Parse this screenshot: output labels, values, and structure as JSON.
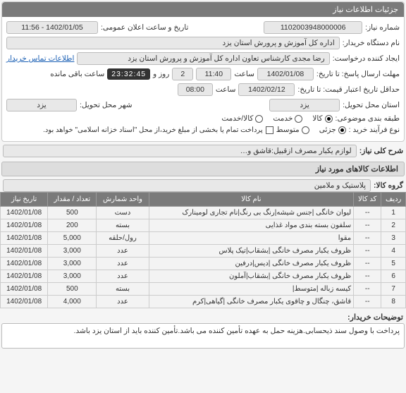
{
  "panel_title": "جزئیات اطلاعات نیاز",
  "fields": {
    "need_no_label": "شماره نیاز:",
    "need_no": "1102003948000006",
    "announce_label": "تاریخ و ساعت اعلان عمومی:",
    "announce_val": "1402/01/05 - 11:56",
    "buyer_org_label": "نام دستگاه خریدار:",
    "buyer_org": "اداره کل آموزش و پرورش استان یزد",
    "requester_label": "ایجاد کننده درخواست:",
    "requester": "رضا مجدی کارشناس تعاون اداره کل آموزش و پرورش استان یزد",
    "buyer_contact_link": "اطلاعات تماس خریدار",
    "deadline_label": "مهلت ارسال پاسخ: تا تاریخ:",
    "deadline_date": "1402/01/08",
    "deadline_time_label": "ساعت",
    "deadline_time": "11:40",
    "day_label": "روز و",
    "days": "2",
    "countdown": "23:32:45",
    "remaining": "ساعت باقی مانده",
    "price_valid_label": "حداقل تاریخ اعتبار قیمت: تا تاریخ:",
    "price_valid_date": "1402/02/12",
    "price_valid_time_label": "ساعت",
    "price_valid_time": "08:00",
    "delivery_prov_label": "استان محل تحویل:",
    "delivery_prov": "یزد",
    "delivery_city_label": "شهر محل تحویل:",
    "delivery_city": "یزد",
    "subject_class_label": "طبقه بندی موضوعی:",
    "radio_kala": "کالا",
    "radio_khadamat": "خدمت",
    "radio_both": "کالا/خدمت",
    "process_label": "نوع فرآیند خرید :",
    "radio_small": "جزئی",
    "radio_medium": "متوسط",
    "process_note": "پرداخت تمام یا بخشی از مبلغ خرید،از محل \"اسناد خزانه اسلامی\" خواهد بود."
  },
  "need_title_label": "شرح کلی نیاز:",
  "need_title": "لوازم یکبار مصرف ازقبیل:قاشق و…",
  "items_info_label": "اطلاعات کالاهای مورد نیاز",
  "group_label": "گروه کالا:",
  "group_value": "پلاستیک و ملامین",
  "table": {
    "headers": {
      "row": "ردیف",
      "code": "کد کالا",
      "name": "نام کالا",
      "unit": "واحد شمارش",
      "qty": "تعداد / مقدار",
      "date": "تاریخ نیاز"
    },
    "rows": [
      {
        "row": "1",
        "code": "--",
        "name": "لیوان خانگی |جنس شیشه|رنگ بی رنگ|نام تجاری لومینارک",
        "unit": "دست",
        "qty": "500",
        "date": "1402/01/08"
      },
      {
        "row": "2",
        "code": "--",
        "name": "سلفون بسته بندی مواد غذایی",
        "unit": "بسته",
        "qty": "200",
        "date": "1402/01/08"
      },
      {
        "row": "3",
        "code": "--",
        "name": "مقوا",
        "unit": "رول/حلقه",
        "qty": "5,000",
        "date": "1402/01/08"
      },
      {
        "row": "4",
        "code": "--",
        "name": "ظروف یکبار مصرف خانگی |بشقاب|تیک پلاس",
        "unit": "عدد",
        "qty": "3,000",
        "date": "1402/01/08"
      },
      {
        "row": "5",
        "code": "--",
        "name": "ظروف یکبار مصرف خانگی |دیس|درفین",
        "unit": "عدد",
        "qty": "3,000",
        "date": "1402/01/08"
      },
      {
        "row": "6",
        "code": "--",
        "name": "ظروف یکبار مصرف خانگی |بشقاب|آملون",
        "unit": "عدد",
        "qty": "3,000",
        "date": "1402/01/08"
      },
      {
        "row": "7",
        "code": "--",
        "name": "کیسه زباله |متوسط|",
        "unit": "بسته",
        "qty": "500",
        "date": "1402/01/08"
      },
      {
        "row": "8",
        "code": "--",
        "name": "قاشق، چنگال و چاقوی یکبار مصرف خانگی |گیاهی|کرم",
        "unit": "عدد",
        "qty": "4,000",
        "date": "1402/01/08"
      }
    ]
  },
  "buyer_desc_label": "توضیحات خریدار:",
  "buyer_desc": "پرداخت با وصول سند ذیحسابی.هزینه حمل به عهده تأمین کننده می باشد.تأمین کننده باید از استان یزد باشد."
}
